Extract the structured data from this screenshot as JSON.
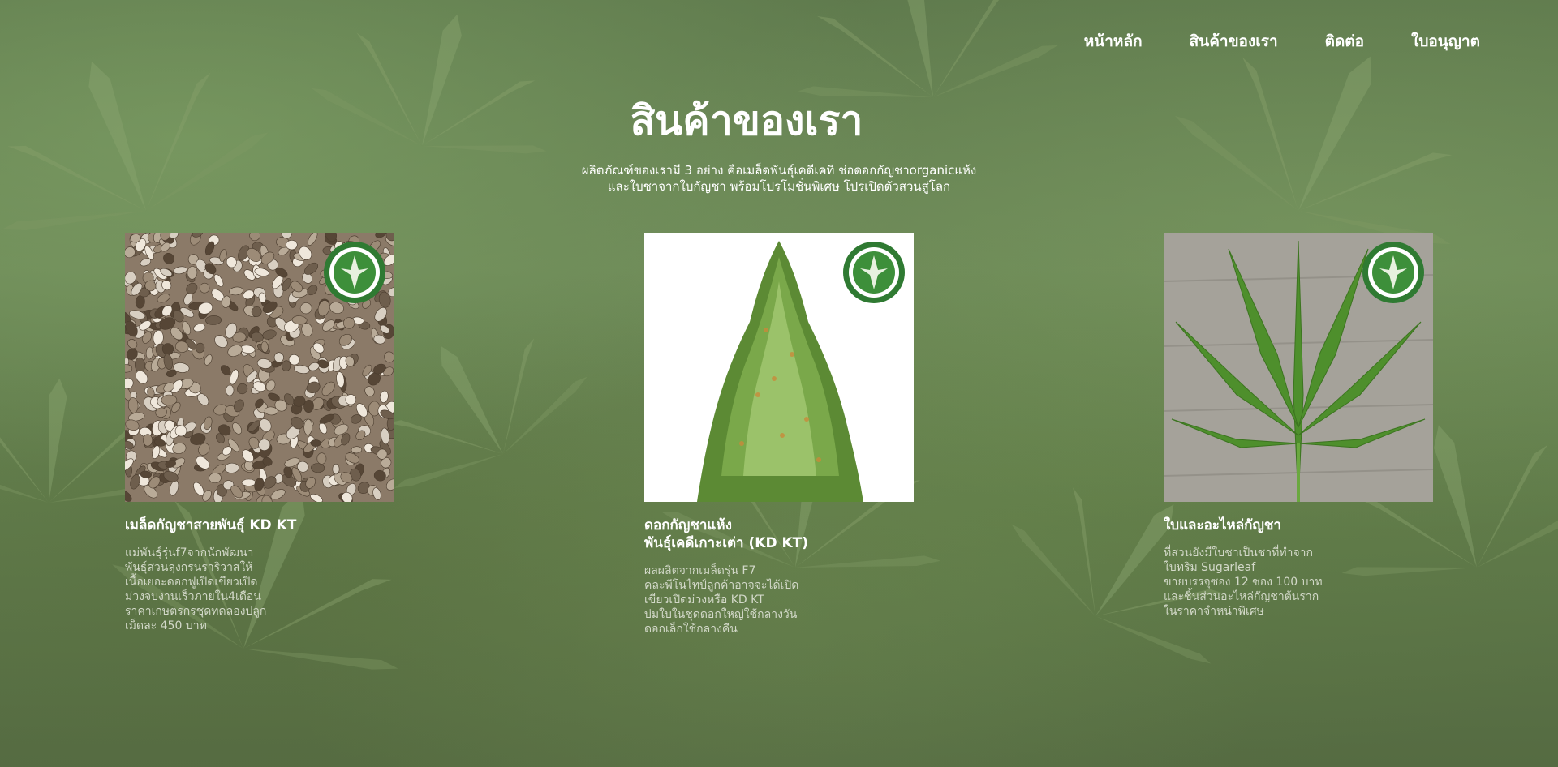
{
  "nav": {
    "items": [
      {
        "label": "หน้าหลัก"
      },
      {
        "label": "สินค้าของเรา"
      },
      {
        "label": "ติดต่อ"
      },
      {
        "label": "ใบอนุญาต"
      }
    ]
  },
  "main": {
    "title": "สินค้าของเรา",
    "intro_lines": [
      "ผลิตภัณฑ์ของเรามี 3 อย่าง คือเมล็ดพันธุ์เคดีเคที ช่อดอกกัญชาorganicแห้ง",
      "และใบชาจากใบกัญชา พร้อมโปรโมชั่นพิเศษ โปรเปิดตัวสวนสู่โลก"
    ]
  },
  "products": [
    {
      "title_lines": [
        "เมล็ดกัญชาสายพันธุ์ KD KT"
      ],
      "desc_lines": [
        "แม่พันธุ์รุ่นf7จากนักพัฒนา",
        "พันธุ์สวนลุงกรนราริวาสให้",
        "เนื้อเยอะดอกฟูเปิดเขียวเปิด",
        "ม่วงจบงานเร็วภายใน4เดือน",
        "ราคาเกษตรกรชุดทดลองปลูก",
        "เม็ดละ 450 บาท"
      ],
      "image_icon": "seeds-image",
      "badge_icon": "green-logo-badge-icon"
    },
    {
      "title_lines": [
        "ดอกกัญชาแห้ง",
        "พันธุ์เคดีเกาะเต่า (KD KT)"
      ],
      "desc_lines": [
        "ผลผลิตจากเมล็ดรุ่น F7",
        "คละพีโนไทป์ลูกค้าอาจจะได้เปิด",
        "เขียวเปิดม่วงหรือ KD KT",
        "บ่มใบในชุดดอกใหญ่ใช้กลางวัน",
        "ดอกเล็กใช้กลางคืน"
      ],
      "image_icon": "cannabis-bud-image",
      "badge_icon": "green-logo-badge-icon"
    },
    {
      "title_lines": [
        "ใบและอะไหล่กัญชา"
      ],
      "desc_lines": [
        "ที่สวนยังมีใบชาเป็นชาที่ทำจาก",
        "ใบทริม Sugarleaf",
        "ขายบรรจุซอง 12 ซอง 100 บาท",
        "และชิ้นส่วนอะไหล่กัญชาต้นราก",
        "ในราคาจำหน่าพิเศษ"
      ],
      "image_icon": "cannabis-leaf-image",
      "badge_icon": "green-logo-badge-icon"
    }
  ]
}
